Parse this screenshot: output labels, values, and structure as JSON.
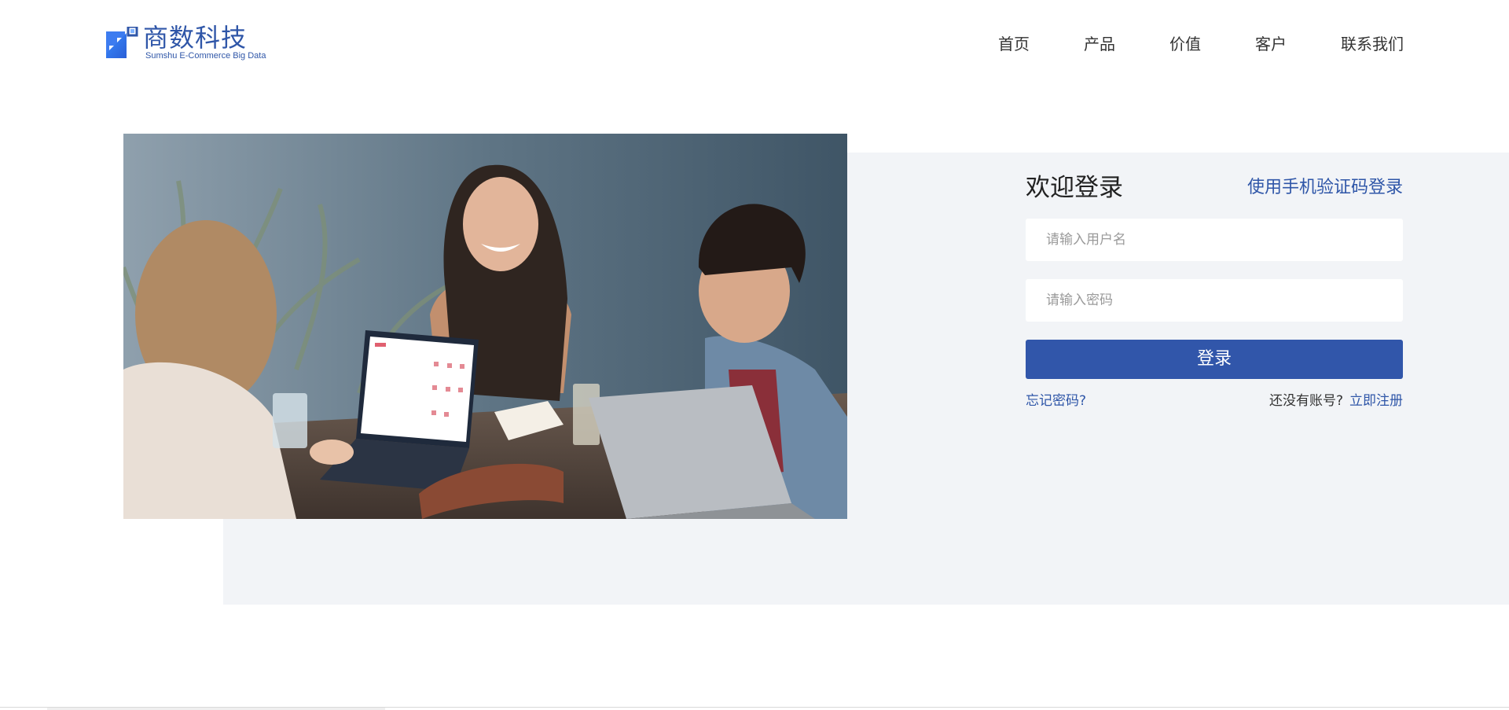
{
  "header": {
    "logo": {
      "name": "商数科技",
      "subtitle": "Sumshu E-Commerce Big Data"
    },
    "nav": [
      {
        "label": "首页"
      },
      {
        "label": "产品"
      },
      {
        "label": "价值"
      },
      {
        "label": "客户"
      },
      {
        "label": "联系我们"
      }
    ]
  },
  "hero": {
    "image": "photo of three people laughing at a table with laptops"
  },
  "login": {
    "title": "欢迎登录",
    "phone_login_link": "使用手机验证码登录",
    "username_placeholder": "请输入用户名",
    "password_placeholder": "请输入密码",
    "submit_label": "登录",
    "forgot_link": "忘记密码?",
    "no_account_text": "还没有账号?",
    "register_link": "立即注册"
  },
  "colors": {
    "brand": "#2f56a8",
    "button": "#3156aa",
    "panel_bg": "#f2f4f7",
    "text": "#333333"
  }
}
